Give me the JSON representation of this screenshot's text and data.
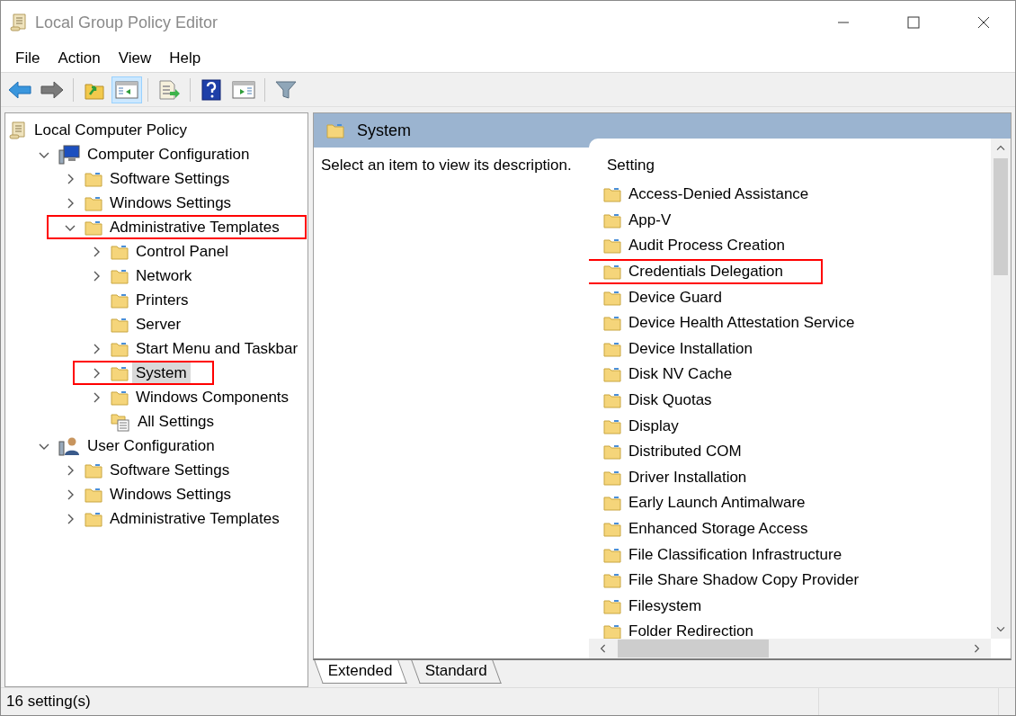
{
  "window": {
    "title": "Local Group Policy Editor"
  },
  "menu": [
    "File",
    "Action",
    "View",
    "Help"
  ],
  "toolbar": [
    {
      "kind": "back",
      "pressed": false
    },
    {
      "kind": "forward",
      "pressed": false
    },
    {
      "kind": "sep"
    },
    {
      "kind": "up",
      "pressed": false
    },
    {
      "kind": "tree",
      "pressed": true
    },
    {
      "kind": "sep"
    },
    {
      "kind": "export",
      "pressed": false
    },
    {
      "kind": "sep"
    },
    {
      "kind": "help",
      "pressed": false
    },
    {
      "kind": "pane",
      "pressed": false
    },
    {
      "kind": "sep"
    },
    {
      "kind": "filter",
      "pressed": false
    }
  ],
  "tree": [
    {
      "label": "Local Computer Policy",
      "kind": "policy",
      "selected": false,
      "highlighted": false,
      "children": [
        {
          "label": "Computer Configuration",
          "kind": "computer",
          "expanded": true,
          "has_children": true,
          "selected": false,
          "highlighted": false,
          "children": [
            {
              "label": "Software Settings",
              "kind": "folder",
              "expanded": false,
              "has_children": true,
              "selected": false,
              "highlighted": false
            },
            {
              "label": "Windows Settings",
              "kind": "folder",
              "expanded": false,
              "has_children": true,
              "selected": false,
              "highlighted": false
            },
            {
              "label": "Administrative Templates",
              "kind": "folder",
              "expanded": true,
              "has_children": true,
              "selected": false,
              "highlighted": true,
              "children": [
                {
                  "label": "Control Panel",
                  "kind": "folder",
                  "expanded": false,
                  "has_children": true,
                  "selected": false,
                  "highlighted": false
                },
                {
                  "label": "Network",
                  "kind": "folder",
                  "expanded": false,
                  "has_children": true,
                  "selected": false,
                  "highlighted": false
                },
                {
                  "label": "Printers",
                  "kind": "folder",
                  "has_children": false,
                  "selected": false,
                  "highlighted": false
                },
                {
                  "label": "Server",
                  "kind": "folder",
                  "has_children": false,
                  "selected": false,
                  "highlighted": false
                },
                {
                  "label": "Start Menu and Taskbar",
                  "kind": "folder",
                  "expanded": false,
                  "has_children": true,
                  "selected": false,
                  "highlighted": false
                },
                {
                  "label": "System",
                  "kind": "folder",
                  "expanded": false,
                  "has_children": true,
                  "selected": true,
                  "highlighted": true
                },
                {
                  "label": "Windows Components",
                  "kind": "folder",
                  "expanded": false,
                  "has_children": true,
                  "selected": false,
                  "highlighted": false
                },
                {
                  "label": "All Settings",
                  "kind": "settings",
                  "has_children": false,
                  "selected": false,
                  "highlighted": false
                }
              ]
            }
          ]
        },
        {
          "label": "User Configuration",
          "kind": "user",
          "expanded": true,
          "has_children": true,
          "selected": false,
          "highlighted": false,
          "children": [
            {
              "label": "Software Settings",
              "kind": "folder",
              "expanded": false,
              "has_children": true,
              "selected": false,
              "highlighted": false
            },
            {
              "label": "Windows Settings",
              "kind": "folder",
              "expanded": false,
              "has_children": true,
              "selected": false,
              "highlighted": false
            },
            {
              "label": "Administrative Templates",
              "kind": "folder",
              "expanded": false,
              "has_children": true,
              "selected": false,
              "highlighted": false
            }
          ]
        }
      ]
    }
  ],
  "details": {
    "header": "System",
    "description": "Select an item to view its description.",
    "column": "Setting",
    "items": [
      {
        "label": "Access-Denied Assistance",
        "highlighted": false
      },
      {
        "label": "App-V",
        "highlighted": false
      },
      {
        "label": "Audit Process Creation",
        "highlighted": false
      },
      {
        "label": "Credentials Delegation",
        "highlighted": true
      },
      {
        "label": "Device Guard",
        "highlighted": false
      },
      {
        "label": "Device Health Attestation Service",
        "highlighted": false
      },
      {
        "label": "Device Installation",
        "highlighted": false
      },
      {
        "label": "Disk NV Cache",
        "highlighted": false
      },
      {
        "label": "Disk Quotas",
        "highlighted": false
      },
      {
        "label": "Display",
        "highlighted": false
      },
      {
        "label": "Distributed COM",
        "highlighted": false
      },
      {
        "label": "Driver Installation",
        "highlighted": false
      },
      {
        "label": "Early Launch Antimalware",
        "highlighted": false
      },
      {
        "label": "Enhanced Storage Access",
        "highlighted": false
      },
      {
        "label": "File Classification Infrastructure",
        "highlighted": false
      },
      {
        "label": "File Share Shadow Copy Provider",
        "highlighted": false
      },
      {
        "label": "Filesystem",
        "highlighted": false
      },
      {
        "label": "Folder Redirection",
        "highlighted": false
      }
    ]
  },
  "tabs": [
    {
      "label": "Extended",
      "selected": true
    },
    {
      "label": "Standard",
      "selected": false
    }
  ],
  "status_bar": "16 setting(s)"
}
